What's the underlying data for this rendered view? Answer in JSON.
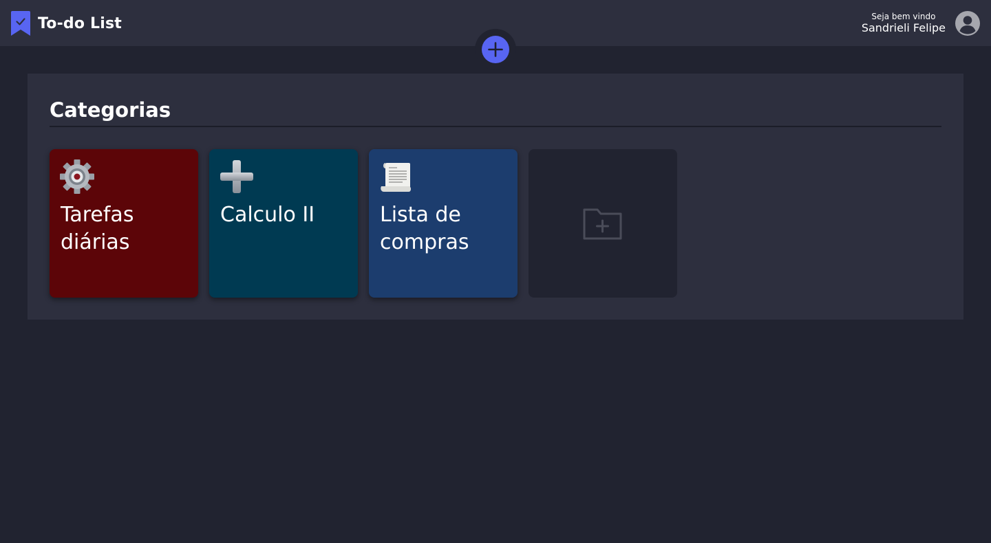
{
  "app": {
    "title": "To-do List",
    "accent_color": "#5865f2"
  },
  "user": {
    "greeting": "Seja bem vindo",
    "name": "Sandrieli Felipe"
  },
  "icons": {
    "brand": "bookmark-check-icon",
    "avatar": "user-avatar-icon",
    "add": "plus-icon",
    "new_category": "folder-plus-icon"
  },
  "categories": {
    "title": "Categorias",
    "items": [
      {
        "label": "Tarefas diárias",
        "color": "#5c0508",
        "icon": "gear-icon"
      },
      {
        "label": "Calculo II",
        "color": "#003a52",
        "icon": "plus-icon"
      },
      {
        "label": "Lista de compras",
        "color": "#1c3d6e",
        "icon": "scroll-icon"
      }
    ],
    "new_card_color": "#212330"
  }
}
